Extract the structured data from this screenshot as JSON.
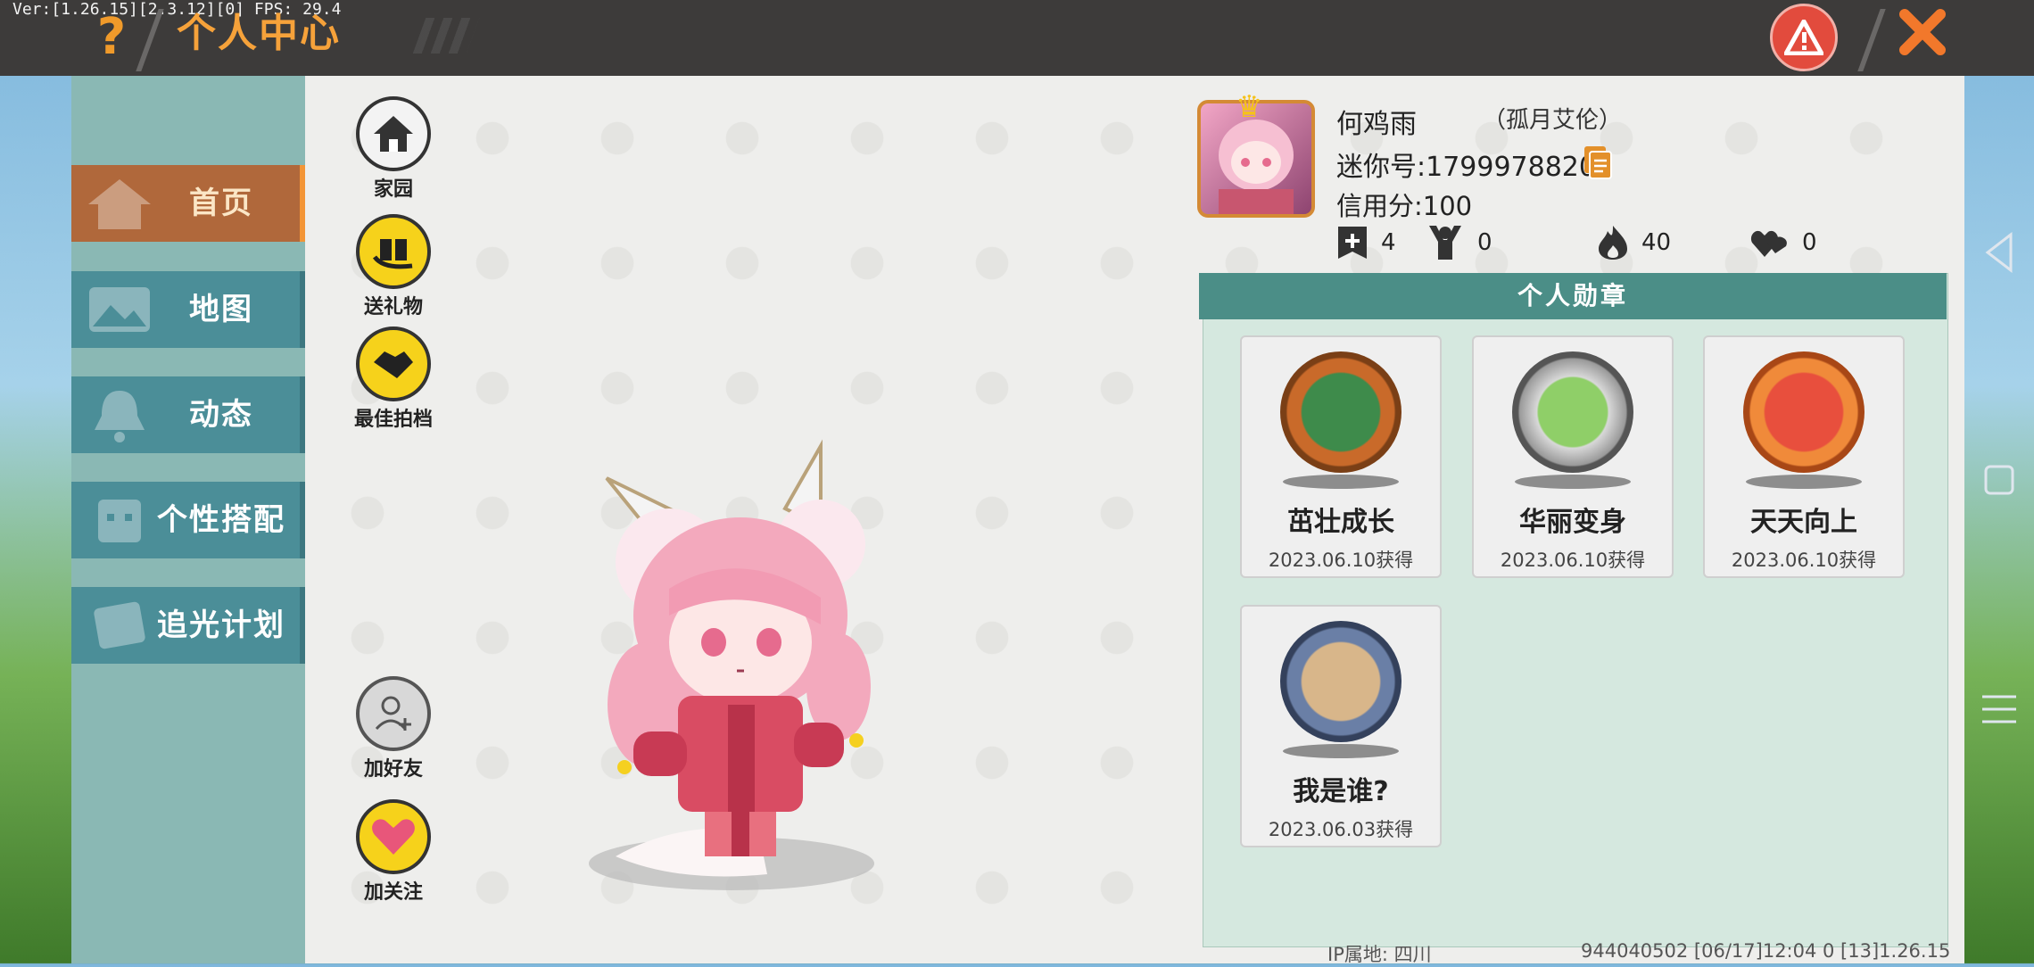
{
  "debug_text": "Ver:[1.26.15][2.3.12][0] FPS: 29.4",
  "header": {
    "help_icon": "?",
    "title": "个人中心",
    "warn_icon": "warning-icon",
    "close_icon": "close-icon"
  },
  "nav": [
    {
      "label": "首页",
      "icon": "house-icon",
      "active": true
    },
    {
      "label": "地图",
      "icon": "map-icon",
      "active": false
    },
    {
      "label": "动态",
      "icon": "bell-icon",
      "active": false
    },
    {
      "label": "个性搭配",
      "icon": "outfit-icon",
      "active": false
    },
    {
      "label": "追光计划",
      "icon": "light-plan-icon",
      "active": false
    }
  ],
  "actions": {
    "home": "家园",
    "gift": "送礼物",
    "partner": "最佳拍档",
    "add_friend": "加好友",
    "follow": "加关注"
  },
  "profile": {
    "name": "何鸡雨",
    "nickname": "（孤月艾伦）",
    "mini_id": "迷你号:1799978820",
    "credit": "信用分:100",
    "stats": {
      "plus": "4",
      "fans": "0",
      "fire": "40",
      "likes": "0"
    }
  },
  "medals": {
    "title": "个人勋章",
    "items": [
      {
        "name": "茁壮成长",
        "date": "2023.06.10获得",
        "color": "#c96a2a"
      },
      {
        "name": "华丽变身",
        "date": "2023.06.10获得",
        "color": "#9a9a9a"
      },
      {
        "name": "天天向上",
        "date": "2023.06.10获得",
        "color": "#c96a2a"
      },
      {
        "name": "我是谁?",
        "date": "2023.06.03获得",
        "color": "#5a6f98"
      }
    ]
  },
  "footer": {
    "ip": "IP属地: 四川",
    "info": "944040502    [06/17]12:04 0  [13]1.26.15"
  }
}
